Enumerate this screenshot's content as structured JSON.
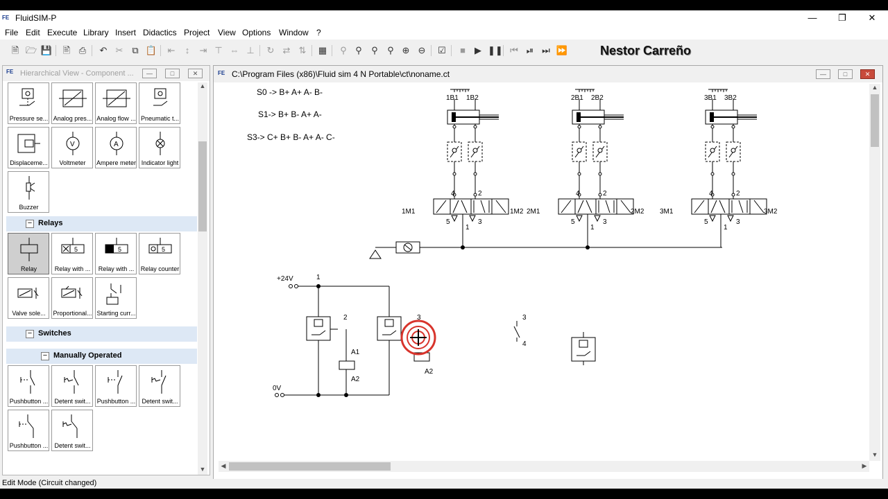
{
  "window": {
    "title": "FluidSIM-P",
    "icon": "festo-icon"
  },
  "menu": [
    "File",
    "Edit",
    "Execute",
    "Library",
    "Insert",
    "Didactics",
    "Project",
    "View",
    "Options",
    "Window",
    "?"
  ],
  "author_label": "Nestor Carreño",
  "library_panel": {
    "title": "Hierarchical View - Component ...",
    "items_top": [
      {
        "label": "Pressure se...",
        "icon": "pressure-sensor-icon"
      },
      {
        "label": "Analog pres...",
        "icon": "analog-pressure-icon"
      },
      {
        "label": "Analog flow ...",
        "icon": "analog-flow-icon"
      },
      {
        "label": "Pneumatic t...",
        "icon": "pneumatic-timer-icon"
      },
      {
        "label": "Displaceme...",
        "icon": "displacement-icon"
      },
      {
        "label": "Voltmeter",
        "icon": "voltmeter-icon"
      },
      {
        "label": "Ampere meter",
        "icon": "ampere-meter-icon"
      },
      {
        "label": "Indicator light",
        "icon": "indicator-light-icon"
      },
      {
        "label": "Buzzer",
        "icon": "buzzer-icon"
      }
    ],
    "group_relays": "Relays",
    "items_relays": [
      {
        "label": "Relay",
        "icon": "relay-icon",
        "selected": true
      },
      {
        "label": "Relay with ...",
        "icon": "relay-with-delay-icon"
      },
      {
        "label": "Relay with ...",
        "icon": "relay-with-delay-icon"
      },
      {
        "label": "Relay counter",
        "icon": "relay-counter-icon"
      },
      {
        "label": "Valve sole...",
        "icon": "valve-solenoid-icon"
      },
      {
        "label": "Proportional...",
        "icon": "proportional-icon"
      },
      {
        "label": "Starting curr...",
        "icon": "starting-current-icon"
      }
    ],
    "group_switches": "Switches",
    "group_manual": "Manually Operated",
    "items_switches": [
      {
        "label": "Pushbutton ...",
        "icon": "pushbutton-icon"
      },
      {
        "label": "Detent swit...",
        "icon": "detent-switch-icon"
      },
      {
        "label": "Pushbutton ...",
        "icon": "pushbutton-icon"
      },
      {
        "label": "Detent swit...",
        "icon": "detent-switch-icon"
      },
      {
        "label": "Pushbutton ...",
        "icon": "pushbutton-icon"
      },
      {
        "label": "Detent swit...",
        "icon": "detent-switch-icon"
      }
    ]
  },
  "document": {
    "path": "C:\\Program Files (x86)\\Fluid sim 4 N Portable\\ct\\noname.ct",
    "sequences": [
      "S0 -> B+ A+ A- B-",
      "S1-> B+ B- A+ A-",
      "S3-> C+ B+ B- A+ A- C-"
    ],
    "cylinders": [
      {
        "sensor_left": "1B1",
        "sensor_right": "1B2",
        "coil_left": "1M1",
        "coil_right": "1M2"
      },
      {
        "sensor_left": "2B1",
        "sensor_right": "2B2",
        "coil_left": "2M1",
        "coil_right": "2M2"
      },
      {
        "sensor_left": "3B1",
        "sensor_right": "3B2",
        "coil_left": "3M1",
        "coil_right": "3M2"
      }
    ],
    "valve_ports": {
      "p4": "4",
      "p2": "2",
      "p5": "5",
      "p3": "3",
      "p1": "1"
    },
    "electrical": {
      "supply_plus": "+24V",
      "supply_zero": "0V",
      "node1": "1",
      "node2": "2",
      "node3": "3",
      "node4": "4",
      "relay_a1": "A1",
      "relay_a2": "A2",
      "relay2_a2": "A2"
    }
  },
  "status_text": "Edit Mode (Circuit changed)"
}
